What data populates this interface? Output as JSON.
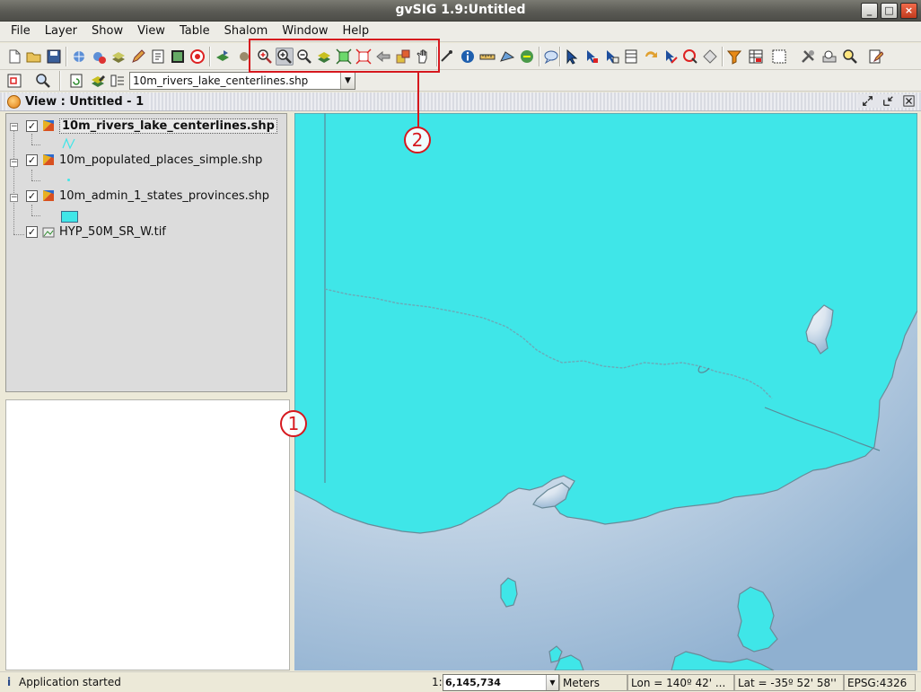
{
  "window": {
    "title": "gvSIG 1.9:Untitled"
  },
  "menubar": {
    "items": [
      "File",
      "Layer",
      "Show",
      "View",
      "Table",
      "Shalom",
      "Window",
      "Help"
    ]
  },
  "toolbar2": {
    "active_layer": "10m_rivers_lake_centerlines.shp"
  },
  "view": {
    "title": "View : Untitled - 1"
  },
  "toc": {
    "layers": [
      {
        "name": "10m_rivers_lake_centerlines.shp",
        "checked": true,
        "selected": true
      },
      {
        "name": "10m_populated_places_simple.shp",
        "checked": true,
        "selected": false
      },
      {
        "name": "10m_admin_1_states_provinces.shp",
        "checked": true,
        "selected": false
      },
      {
        "name": "HYP_50M_SR_W.tif",
        "checked": true,
        "selected": false
      }
    ]
  },
  "callouts": {
    "one": "1",
    "two": "2"
  },
  "statusbar": {
    "message": "Application started",
    "scale_prefix": "1:",
    "scale": "6,145,734",
    "units": "Meters",
    "lon": "Lon = 140º 42' ...",
    "lat": "Lat = -35º 52' 58''",
    "epsg": "EPSG:4326"
  },
  "colors": {
    "land_fill": "#3fe6e8",
    "callout": "#d6181e",
    "sea_light": "#dce6f0",
    "sea_dark": "#9ab6d2"
  }
}
